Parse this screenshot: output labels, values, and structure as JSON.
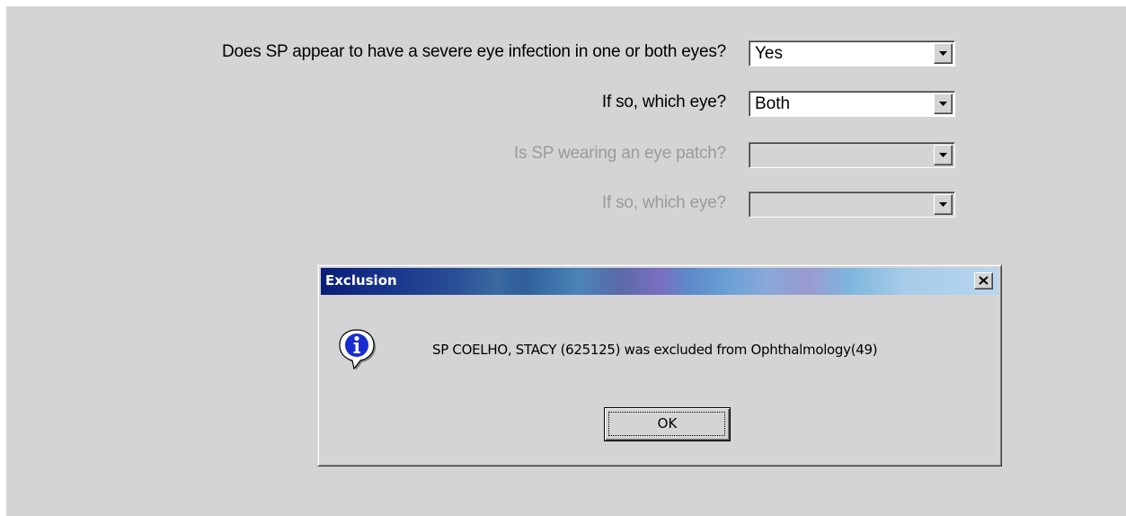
{
  "form": {
    "questions": [
      {
        "label": "Does SP appear to have a severe eye infection in one or both eyes?",
        "value": "Yes",
        "enabled": true
      },
      {
        "label": "If so, which eye?",
        "value": "Both",
        "enabled": true
      },
      {
        "label": "Is SP wearing an eye patch?",
        "value": "",
        "enabled": false
      },
      {
        "label": "If so, which eye?",
        "value": "",
        "enabled": false
      }
    ]
  },
  "dialog": {
    "title": "Exclusion",
    "message": "SP COELHO, STACY  (625125) was excluded from Ophthalmology(49)",
    "ok_label": "OK",
    "icon": "info-icon"
  },
  "colors": {
    "page_bg": "#d4d4d4",
    "disabled_text": "#9a9a9a",
    "title_gradient_start": "#0a1e79",
    "title_gradient_end": "#b8d6f0"
  }
}
